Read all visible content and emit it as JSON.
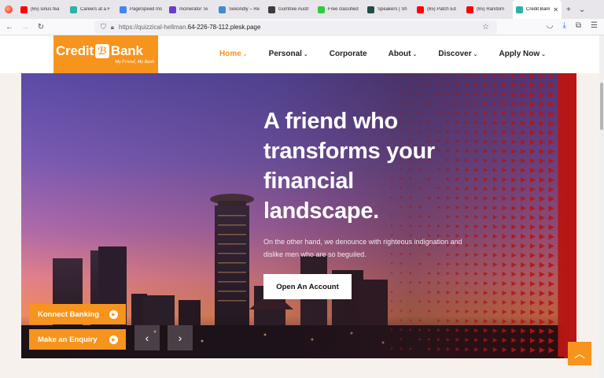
{
  "browser": {
    "tabs": [
      {
        "title": "(65) sirius fea",
        "color": "#ff0000"
      },
      {
        "title": "Careers at a F",
        "color": "#2ab3a6"
      },
      {
        "title": "PageSpeed Ins",
        "color": "#4285f4"
      },
      {
        "title": "Incinerator Te",
        "color": "#6a3cc9"
      },
      {
        "title": "Sekondly – Re",
        "color": "#3d8bd9"
      },
      {
        "title": "Gumtree Austr",
        "color": "#3b3b3b"
      },
      {
        "title": "Free classified",
        "color": "#2ecc40"
      },
      {
        "title": "Speakers | Sh",
        "color": "#1e4d4a"
      },
      {
        "title": "(65) Patch Ed",
        "color": "#ff0000"
      },
      {
        "title": "(65) Random",
        "color": "#ff0000"
      }
    ],
    "active_tab": {
      "title": "Credit Bank",
      "color": "#2ab3a6"
    },
    "url_prefix": "https://quizzical-hellman.",
    "url_host": "64-226-78-112.plesk.page"
  },
  "site": {
    "logo_left": "Credit",
    "logo_mark": "ℬ",
    "logo_right": "Bank",
    "logo_tagline": "My Friend, My Bank",
    "menu": [
      {
        "label": "Home",
        "active": true
      },
      {
        "label": "Personal"
      },
      {
        "label": "Corporate"
      },
      {
        "label": "About"
      },
      {
        "label": "Discover"
      },
      {
        "label": "Apply Now"
      }
    ],
    "chevron": "⌄"
  },
  "hero": {
    "headline_lines": [
      "A friend who",
      "transforms your",
      "financial",
      "landscape."
    ],
    "subtext": "On the other hand, we denounce with righteous indignation and dislike men who are so beguiled.",
    "cta": "Open An Account",
    "side_buttons": [
      "Konnect Banking",
      "Make an Enquiry"
    ],
    "prev": "‹",
    "next": "›"
  },
  "colors": {
    "brand": "#f7941d",
    "red_pattern": "#e5201c"
  }
}
